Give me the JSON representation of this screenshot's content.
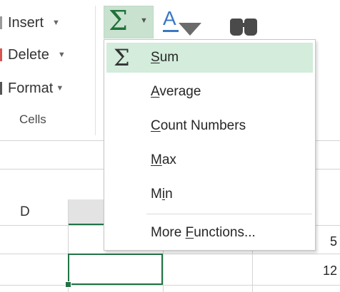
{
  "ribbon": {
    "cells_group": {
      "insert_label": "Insert",
      "delete_label": "Delete",
      "format_label": "Format",
      "group_label": "Cells"
    },
    "editing": {
      "autosum_icon": "sigma-icon",
      "sort_filter_icon": "sort-filter-icon",
      "find_icon": "binoculars-icon"
    }
  },
  "grid": {
    "column_header_d": "D",
    "rows": [
      {
        "value": "5"
      },
      {
        "value": "12"
      }
    ]
  },
  "autosum_menu": {
    "items": [
      {
        "key": "sum",
        "pre": "",
        "u": "S",
        "post": "um",
        "icon": "sigma-icon"
      },
      {
        "key": "average",
        "pre": "",
        "u": "A",
        "post": "verage"
      },
      {
        "key": "count",
        "pre": "",
        "u": "C",
        "post": "ount Numbers"
      },
      {
        "key": "max",
        "pre": "",
        "u": "M",
        "post": "ax"
      },
      {
        "key": "min",
        "pre": "M",
        "u": "i",
        "post": "n"
      },
      {
        "key": "more",
        "pre": "More ",
        "u": "F",
        "post": "unctions..."
      }
    ]
  },
  "colors": {
    "accent_green": "#217346",
    "menu_highlight": "#d3ecdb",
    "button_pressed": "#c9e2d0"
  }
}
